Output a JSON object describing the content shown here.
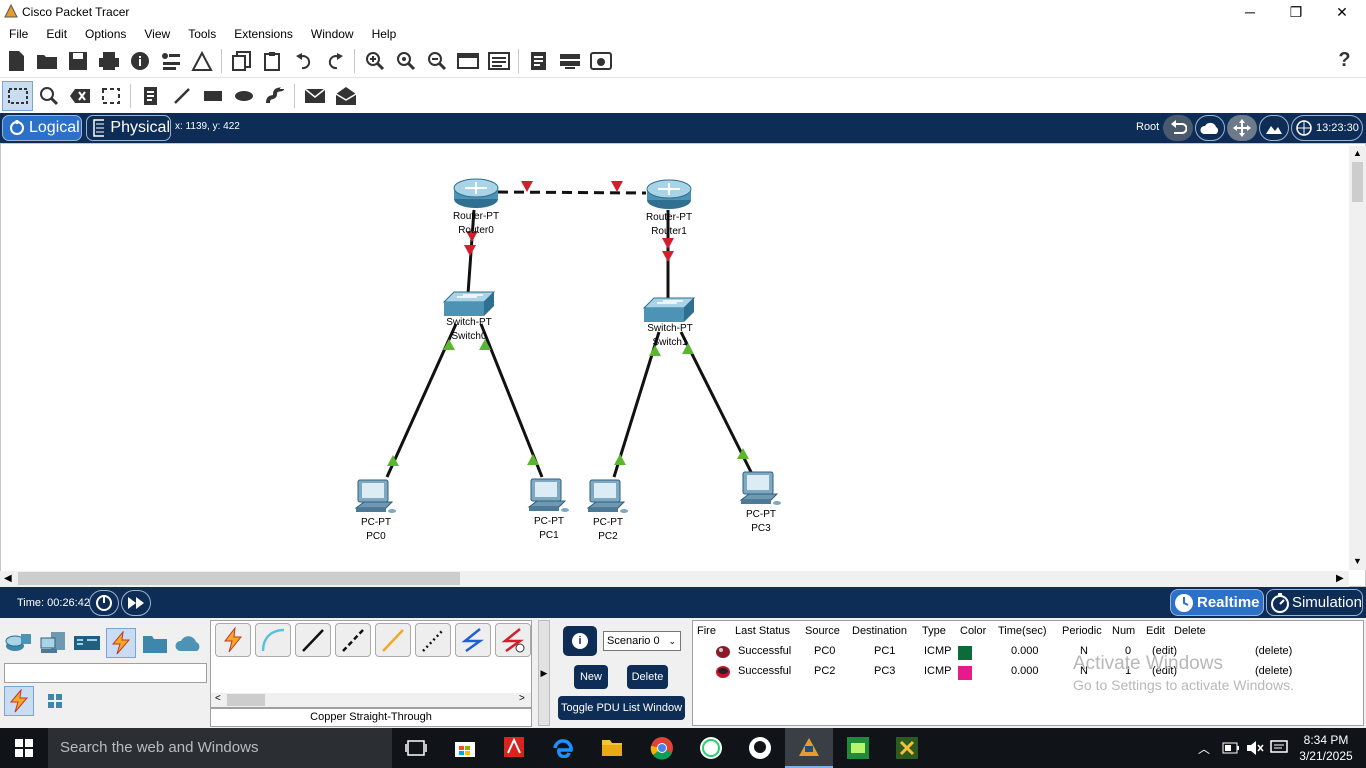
{
  "window": {
    "title": "Cisco Packet Tracer",
    "minimize": "─",
    "maximize": "❐",
    "close": "✕"
  },
  "menu": [
    "File",
    "Edit",
    "Options",
    "View",
    "Tools",
    "Extensions",
    "Window",
    "Help"
  ],
  "help_glyph": "?",
  "nav": {
    "logical": "Logical",
    "physical": "Physical",
    "coords": "x: 1139, y: 422",
    "root": "Root",
    "clock": "13:23:30"
  },
  "devices": [
    {
      "type": "Router-PT",
      "name": "Router0"
    },
    {
      "type": "Router-PT",
      "name": "Router1"
    },
    {
      "type": "Switch-PT",
      "name": "Switch0"
    },
    {
      "type": "Switch-PT",
      "name": "Switch1"
    },
    {
      "type": "PC-PT",
      "name": "PC0"
    },
    {
      "type": "PC-PT",
      "name": "PC1"
    },
    {
      "type": "PC-PT",
      "name": "PC2"
    },
    {
      "type": "PC-PT",
      "name": "PC3"
    }
  ],
  "link_colors": {
    "up": "#5cb531",
    "down": "#d0202e"
  },
  "status": {
    "time": "Time: 00:26:42",
    "realtime": "Realtime",
    "simulation": "Simulation"
  },
  "connections": {
    "selected_label": "Copper Straight-Through",
    "search_value": ""
  },
  "scenario": {
    "selected": "Scenario 0",
    "info": "i",
    "new": "New",
    "delete": "Delete",
    "toggle": "Toggle PDU List Window"
  },
  "pdu": {
    "headers": [
      "Fire",
      "Last Status",
      "Source",
      "Destination",
      "Type",
      "Color",
      "Time(sec)",
      "Periodic",
      "Num",
      "Edit",
      "Delete"
    ],
    "rows": [
      {
        "status": "Successful",
        "source": "PC0",
        "destination": "PC1",
        "type": "ICMP",
        "color": "#0b6b3a",
        "time": "0.000",
        "periodic": "N",
        "num": "0",
        "edit": "(edit)",
        "delete": "(delete)"
      },
      {
        "status": "Successful",
        "source": "PC2",
        "destination": "PC3",
        "type": "ICMP",
        "color": "#e8198b",
        "time": "0.000",
        "periodic": "N",
        "num": "1",
        "edit": "(edit)",
        "delete": "(delete)"
      }
    ]
  },
  "watermark": {
    "line1": "Activate Windows",
    "line2": "Go to Settings to activate Windows."
  },
  "taskbar": {
    "search": "Search the web and Windows",
    "time": "8:34 PM",
    "date": "3/21/2025"
  }
}
